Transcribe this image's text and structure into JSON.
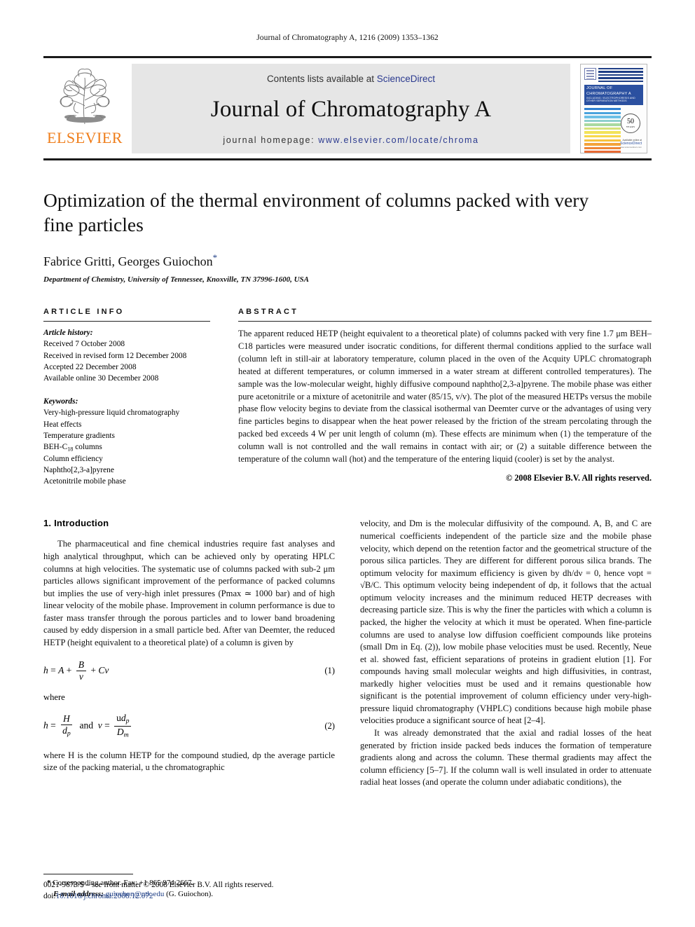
{
  "running_head": "Journal of Chromatography A, 1216 (2009) 1353–1362",
  "masthead": {
    "publisher_name": "ELSEVIER",
    "contents_prefix": "Contents lists available at ",
    "sciencedirect": "ScienceDirect",
    "journal_title": "Journal of Chromatography A",
    "homepage_prefix": "journal homepage: ",
    "homepage_url": "www.elsevier.com/locate/chroma",
    "accent_orange": "#ef7d1a",
    "link_blue": "#2b3a8f"
  },
  "cover": {
    "title": "JOURNAL OF CHROMATOGRAPHY A",
    "subtitle": "INCLUDING / ELECTROPHORESIS AND OTHER SEPARATION METHODS",
    "seal_number": "50",
    "seal_label": "YEARS",
    "foot_line1": "Available online at",
    "foot_line2": "ScienceDirect",
    "foot_line3": "www.sciencedirect.com"
  },
  "article": {
    "title": "Optimization of the thermal environment of columns packed with very fine particles",
    "authors": "Fabrice Gritti, Georges Guiochon",
    "corresponding_marker": "*",
    "affiliation": "Department of Chemistry, University of Tennessee, Knoxville, TN 37996-1600, USA"
  },
  "article_info": {
    "heading": "ARTICLE INFO",
    "history_label": "Article history:",
    "history": [
      "Received 7 October 2008",
      "Received in revised form 12 December 2008",
      "Accepted 22 December 2008",
      "Available online 30 December 2008"
    ],
    "keywords_label": "Keywords:",
    "keywords": [
      "Very-high-pressure liquid chromatography",
      "Heat effects",
      "Temperature gradients",
      "BEH-C18 columns",
      "Column efficiency",
      "Naphtho[2,3-a]pyrene",
      "Acetonitrile mobile phase"
    ],
    "keyword_beh_prefix": "BEH-C",
    "keyword_beh_sub": "18",
    "keyword_beh_suffix": " columns"
  },
  "abstract": {
    "heading": "ABSTRACT",
    "text": "The apparent reduced HETP (height equivalent to a theoretical plate) of columns packed with very fine 1.7 μm BEH–C18 particles were measured under isocratic conditions, for different thermal conditions applied to the surface wall (column left in still-air at laboratory temperature, column placed in the oven of the Acquity UPLC chromatograph heated at different temperatures, or column immersed in a water stream at different controlled temperatures). The sample was the low-molecular weight, highly diffusive compound naphtho[2,3-a]pyrene. The mobile phase was either pure acetonitrile or a mixture of acetonitrile and water (85/15, v/v). The plot of the measured HETPs versus the mobile phase flow velocity begins to deviate from the classical isothermal van Deemter curve or the advantages of using very fine particles begins to disappear when the heat power released by the friction of the stream percolating through the packed bed exceeds 4 W per unit length of column (m). These effects are minimum when (1) the temperature of the column wall is not controlled and the wall remains in contact with air; or (2) a suitable difference between the temperature of the column wall (hot) and the temperature of the entering liquid (cooler) is set by the analyst.",
    "copyright": "© 2008 Elsevier B.V. All rights reserved."
  },
  "body": {
    "section_number": "1.",
    "section_title": "Introduction",
    "left_para_1": "The pharmaceutical and fine chemical industries require fast analyses and high analytical throughput, which can be achieved only by operating HPLC columns at high velocities. The systematic use of columns packed with sub-2 μm particles allows significant improvement of the performance of packed columns but implies the use of very-high inlet pressures (Pmax ≃ 1000 bar) and of high linear velocity of the mobile phase. Improvement in column performance is due to faster mass transfer through the porous particles and to lower band broadening caused by eddy dispersion in a small particle bed. After van Deemter, the reduced HETP (height equivalent to a theoretical plate) of a column is given by",
    "eq1_number": "(1)",
    "where_label": "where",
    "eq2_number": "(2)",
    "left_para_2": "where H is the column HETP for the compound studied, dp the average particle size of the packing material, u the chromatographic",
    "right_para_1": "velocity, and Dm is the molecular diffusivity of the compound. A, B, and C are numerical coefficients independent of the particle size and the mobile phase velocity, which depend on the retention factor and the geometrical structure of the porous silica particles. They are different for different porous silica brands. The optimum velocity for maximum efficiency is given by dh/dν = 0, hence νopt = √B/C. This optimum velocity being independent of dp, it follows that the actual optimum velocity increases and the minimum reduced HETP decreases with decreasing particle size. This is why the finer the particles with which a column is packed, the higher the velocity at which it must be operated. When fine-particle columns are used to analyse low diffusion coefficient compounds like proteins (small Dm in Eq. (2)), low mobile phase velocities must be used. Recently, Neue et al. showed fast, efficient separations of proteins in gradient elution [1]. For compounds having small molecular weights and high diffusivities, in contrast, markedly higher velocities must be used and it remains questionable how significant is the potential improvement of column efficiency under very-high-pressure liquid chromatography (VHPLC) conditions because high mobile phase velocities produce a significant source of heat [2–4].",
    "right_para_2": "It was already demonstrated that the axial and radial losses of the heat generated by friction inside packed beds induces the formation of temperature gradients along and across the column. These thermal gradients may affect the column efficiency [5–7]. If the column wall is well insulated in order to attenuate radial heat losses (and operate the column under adiabatic conditions), the"
  },
  "footnote": {
    "star": "*",
    "corresponding": "Corresponding author. Fax: +1 865 974 2667.",
    "email_label": "E-mail address:",
    "email": "guiochon@utk.edu",
    "email_suffix": "(G. Guiochon)."
  },
  "imprint": {
    "line1": "0021-9673/$ – see front matter © 2008 Elsevier B.V. All rights reserved.",
    "doi_label": "doi:",
    "doi": "10.1016/j.chroma.2008.12.072"
  }
}
